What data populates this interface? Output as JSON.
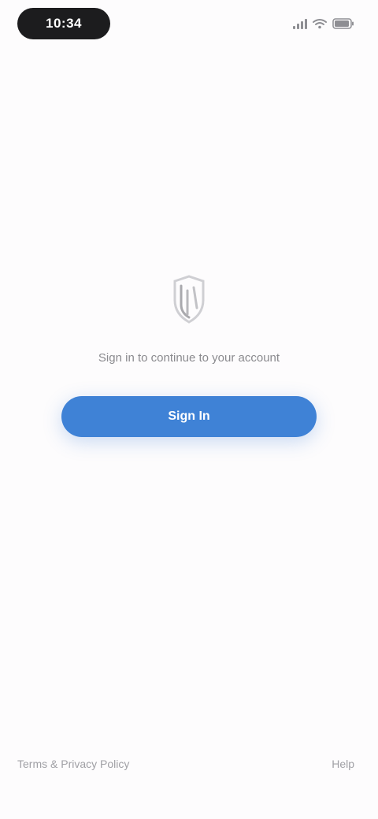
{
  "status_bar": {
    "time": "10:34",
    "icons": [
      "signal-icon",
      "wifi-icon",
      "battery-icon"
    ]
  },
  "main": {
    "logo_icon": "app-logo-icon",
    "message": "Sign in to continue to your account",
    "button_label": "Sign In"
  },
  "footer": {
    "left_text": "Terms & Privacy Policy",
    "right_link": "Help"
  },
  "colors": {
    "accent": "#3f82d6",
    "background": "#fdfcfd",
    "muted_text": "#8a8a8e"
  }
}
